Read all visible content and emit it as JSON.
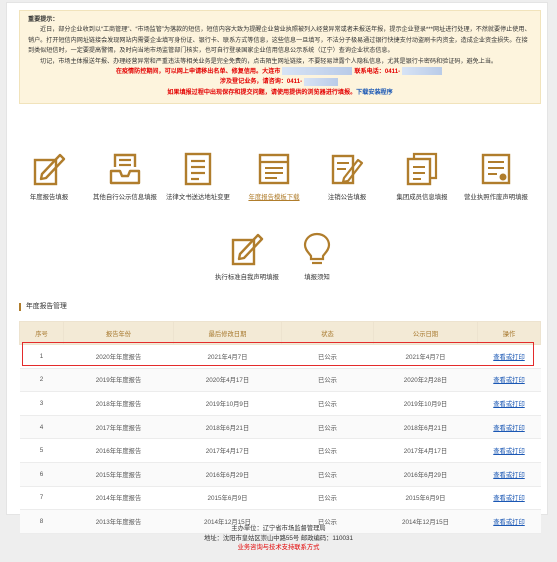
{
  "notice": {
    "heading": "重要提示：",
    "para1": "近日，部分企业收到以“工商管理”、“市场监管”为落款的短信，短信内容大致为提醒企业营业执照被列入经营异常或者未报送年报，提示企业登录***网址进行处理，不然就要停止使用、销户。打开短信内网址链接会发现网站内需要企业填写身份证、银行卡、联系方式等信息，这些信息一旦填写，不法分子极易通过银行快捷支付动盗刷卡内资金，造成企业资金损失。在接到类似短信时，一定要提高警惕，及时向当地市场监管部门核实，也可自行登录国家企业信用信息公示系统（辽宁）查询企业状态信息。",
    "para2": "切记，市场主体报送年报、办理经营异常和严重违法等相关业务是完全免费的，点击陌生网址链接，不要轻易泄露个人隐私信息，尤其是银行卡密码和验证码，避免上当。",
    "red1_a": "在疫情防控期间，可以网上申请移出名单、修复信用。大连市",
    "red1_b": "联系电话：",
    "red1_phone": "0411-",
    "red2_a": "涉及登记业务，请咨询：",
    "red2_phone": "0411-",
    "red3": "如果填报过程中出现保存和提交问题，请使用提供的浏览器进行填报。",
    "red3_link": "下载安装程序"
  },
  "icons": [
    {
      "label": "年度报告填报",
      "icon": "edit-report-icon"
    },
    {
      "label": "其他自行公示信息填报",
      "icon": "inbox-stack-icon"
    },
    {
      "label": "法律文书送达地址变更",
      "icon": "document-list-icon"
    },
    {
      "label": "年度报告模板下载",
      "icon": "report-template-icon"
    },
    {
      "label": "注销公告填报",
      "icon": "cancel-notice-icon"
    },
    {
      "label": "集团成员信息填报",
      "icon": "group-members-icon"
    },
    {
      "label": "营业执照作废声明填报",
      "icon": "license-void-icon"
    },
    {
      "label": "执行标准自我声明填报",
      "icon": "standard-declaration-icon"
    },
    {
      "label": "填报须知",
      "icon": "lightbulb-icon"
    }
  ],
  "section_title": "年度报告管理",
  "table": {
    "headers": [
      "序号",
      "报告年份",
      "最后修改日期",
      "状态",
      "公示日期",
      "操作"
    ],
    "rows": [
      [
        "1",
        "2020年年度报告",
        "2021年4月7日",
        "已公示",
        "2021年4月7日",
        "查看或打印"
      ],
      [
        "2",
        "2019年年度报告",
        "2020年4月17日",
        "已公示",
        "2020年2月28日",
        "查看或打印"
      ],
      [
        "3",
        "2018年年度报告",
        "2019年10月9日",
        "已公示",
        "2019年10月9日",
        "查看或打印"
      ],
      [
        "4",
        "2017年年度报告",
        "2018年6月21日",
        "已公示",
        "2018年6月21日",
        "查看或打印"
      ],
      [
        "5",
        "2016年年度报告",
        "2017年4月17日",
        "已公示",
        "2017年4月17日",
        "查看或打印"
      ],
      [
        "6",
        "2015年年度报告",
        "2016年6月29日",
        "已公示",
        "2016年6月29日",
        "查看或打印"
      ],
      [
        "7",
        "2014年年度报告",
        "2015年6月9日",
        "已公示",
        "2015年6月9日",
        "查看或打印"
      ],
      [
        "8",
        "2013年年度报告",
        "2014年12月15日",
        "已公示",
        "2014年12月15日",
        "查看或打印"
      ]
    ]
  },
  "footer": {
    "line1": "主办单位：辽宁省市场监督管理局",
    "line2": "地址：沈阳市皇姑区崇山中路55号 邮政编码：110031",
    "line3": "业务咨询与技术支持联系方式"
  },
  "colors": {
    "accent": "#b07d2c",
    "header_bg": "#f3ead6",
    "notice_bg": "#fdf4dd",
    "alert_red": "#e30000",
    "link_blue": "#1a57b4"
  }
}
